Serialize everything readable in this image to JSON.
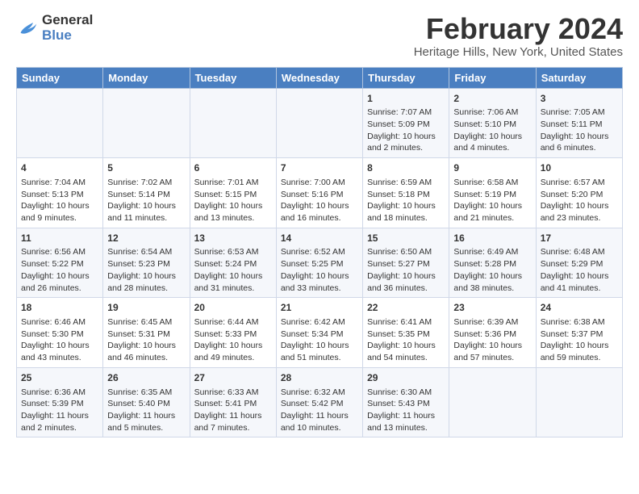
{
  "header": {
    "logo_line1": "General",
    "logo_line2": "Blue",
    "title": "February 2024",
    "subtitle": "Heritage Hills, New York, United States"
  },
  "days_of_week": [
    "Sunday",
    "Monday",
    "Tuesday",
    "Wednesday",
    "Thursday",
    "Friday",
    "Saturday"
  ],
  "weeks": [
    [
      {
        "day": "",
        "content": ""
      },
      {
        "day": "",
        "content": ""
      },
      {
        "day": "",
        "content": ""
      },
      {
        "day": "",
        "content": ""
      },
      {
        "day": "1",
        "content": "Sunrise: 7:07 AM\nSunset: 5:09 PM\nDaylight: 10 hours\nand 2 minutes."
      },
      {
        "day": "2",
        "content": "Sunrise: 7:06 AM\nSunset: 5:10 PM\nDaylight: 10 hours\nand 4 minutes."
      },
      {
        "day": "3",
        "content": "Sunrise: 7:05 AM\nSunset: 5:11 PM\nDaylight: 10 hours\nand 6 minutes."
      }
    ],
    [
      {
        "day": "4",
        "content": "Sunrise: 7:04 AM\nSunset: 5:13 PM\nDaylight: 10 hours\nand 9 minutes."
      },
      {
        "day": "5",
        "content": "Sunrise: 7:02 AM\nSunset: 5:14 PM\nDaylight: 10 hours\nand 11 minutes."
      },
      {
        "day": "6",
        "content": "Sunrise: 7:01 AM\nSunset: 5:15 PM\nDaylight: 10 hours\nand 13 minutes."
      },
      {
        "day": "7",
        "content": "Sunrise: 7:00 AM\nSunset: 5:16 PM\nDaylight: 10 hours\nand 16 minutes."
      },
      {
        "day": "8",
        "content": "Sunrise: 6:59 AM\nSunset: 5:18 PM\nDaylight: 10 hours\nand 18 minutes."
      },
      {
        "day": "9",
        "content": "Sunrise: 6:58 AM\nSunset: 5:19 PM\nDaylight: 10 hours\nand 21 minutes."
      },
      {
        "day": "10",
        "content": "Sunrise: 6:57 AM\nSunset: 5:20 PM\nDaylight: 10 hours\nand 23 minutes."
      }
    ],
    [
      {
        "day": "11",
        "content": "Sunrise: 6:56 AM\nSunset: 5:22 PM\nDaylight: 10 hours\nand 26 minutes."
      },
      {
        "day": "12",
        "content": "Sunrise: 6:54 AM\nSunset: 5:23 PM\nDaylight: 10 hours\nand 28 minutes."
      },
      {
        "day": "13",
        "content": "Sunrise: 6:53 AM\nSunset: 5:24 PM\nDaylight: 10 hours\nand 31 minutes."
      },
      {
        "day": "14",
        "content": "Sunrise: 6:52 AM\nSunset: 5:25 PM\nDaylight: 10 hours\nand 33 minutes."
      },
      {
        "day": "15",
        "content": "Sunrise: 6:50 AM\nSunset: 5:27 PM\nDaylight: 10 hours\nand 36 minutes."
      },
      {
        "day": "16",
        "content": "Sunrise: 6:49 AM\nSunset: 5:28 PM\nDaylight: 10 hours\nand 38 minutes."
      },
      {
        "day": "17",
        "content": "Sunrise: 6:48 AM\nSunset: 5:29 PM\nDaylight: 10 hours\nand 41 minutes."
      }
    ],
    [
      {
        "day": "18",
        "content": "Sunrise: 6:46 AM\nSunset: 5:30 PM\nDaylight: 10 hours\nand 43 minutes."
      },
      {
        "day": "19",
        "content": "Sunrise: 6:45 AM\nSunset: 5:31 PM\nDaylight: 10 hours\nand 46 minutes."
      },
      {
        "day": "20",
        "content": "Sunrise: 6:44 AM\nSunset: 5:33 PM\nDaylight: 10 hours\nand 49 minutes."
      },
      {
        "day": "21",
        "content": "Sunrise: 6:42 AM\nSunset: 5:34 PM\nDaylight: 10 hours\nand 51 minutes."
      },
      {
        "day": "22",
        "content": "Sunrise: 6:41 AM\nSunset: 5:35 PM\nDaylight: 10 hours\nand 54 minutes."
      },
      {
        "day": "23",
        "content": "Sunrise: 6:39 AM\nSunset: 5:36 PM\nDaylight: 10 hours\nand 57 minutes."
      },
      {
        "day": "24",
        "content": "Sunrise: 6:38 AM\nSunset: 5:37 PM\nDaylight: 10 hours\nand 59 minutes."
      }
    ],
    [
      {
        "day": "25",
        "content": "Sunrise: 6:36 AM\nSunset: 5:39 PM\nDaylight: 11 hours\nand 2 minutes."
      },
      {
        "day": "26",
        "content": "Sunrise: 6:35 AM\nSunset: 5:40 PM\nDaylight: 11 hours\nand 5 minutes."
      },
      {
        "day": "27",
        "content": "Sunrise: 6:33 AM\nSunset: 5:41 PM\nDaylight: 11 hours\nand 7 minutes."
      },
      {
        "day": "28",
        "content": "Sunrise: 6:32 AM\nSunset: 5:42 PM\nDaylight: 11 hours\nand 10 minutes."
      },
      {
        "day": "29",
        "content": "Sunrise: 6:30 AM\nSunset: 5:43 PM\nDaylight: 11 hours\nand 13 minutes."
      },
      {
        "day": "",
        "content": ""
      },
      {
        "day": "",
        "content": ""
      }
    ]
  ]
}
